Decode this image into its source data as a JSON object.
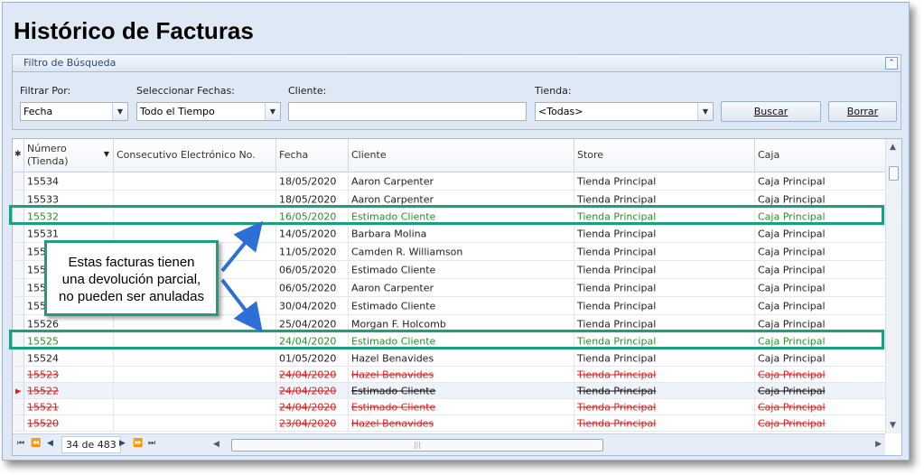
{
  "page": {
    "title": "Histórico de Facturas"
  },
  "filter": {
    "header": "Filtro de Búsqueda",
    "filter_by_label": "Filtrar Por:",
    "filter_by_value": "Fecha",
    "dates_label": "Seleccionar Fechas:",
    "dates_value": "Todo el Tiempo",
    "client_label": "Cliente:",
    "client_value": "",
    "store_label": "Tienda:",
    "store_value": "<Todas>",
    "search_button": "Buscar",
    "clear_button": "Borrar"
  },
  "grid": {
    "headers": {
      "numero_line1": "Número",
      "numero_line2": "(Tienda)",
      "consecutivo": "Consecutivo Electrónico No.",
      "fecha": "Fecha",
      "cliente": "Cliente",
      "store": "Store",
      "caja": "Caja"
    },
    "rows": [
      {
        "numero": "15534",
        "fecha": "18/05/2020",
        "cliente": "Aaron Carpenter",
        "store": "Tienda Principal",
        "caja": "Caja Principal",
        "status": "normal"
      },
      {
        "numero": "15533",
        "fecha": "18/05/2020",
        "cliente": "Aaron Carpenter",
        "store": "Tienda Principal",
        "caja": "Caja Principal",
        "status": "normal"
      },
      {
        "numero": "15532",
        "fecha": "16/05/2020",
        "cliente": "Estimado Cliente",
        "store": "Tienda Principal",
        "caja": "Caja Principal",
        "status": "partial"
      },
      {
        "numero": "15531",
        "fecha": "14/05/2020",
        "cliente": "Barbara Molina",
        "store": "Tienda Principal",
        "caja": "Caja Principal",
        "status": "normal"
      },
      {
        "numero": "15530",
        "fecha": "11/05/2020",
        "cliente": "Camden R. Williamson",
        "store": "Tienda Principal",
        "caja": "Caja Principal",
        "status": "normal"
      },
      {
        "numero": "15529",
        "fecha": "06/05/2020",
        "cliente": "Estimado Cliente",
        "store": "Tienda Principal",
        "caja": "Caja Principal",
        "status": "normal"
      },
      {
        "numero": "15528",
        "fecha": "06/05/2020",
        "cliente": "Aaron Carpenter",
        "store": "Tienda Principal",
        "caja": "Caja Principal",
        "status": "normal"
      },
      {
        "numero": "15527",
        "fecha": "30/04/2020",
        "cliente": "Estimado Cliente",
        "store": "Tienda Principal",
        "caja": "Caja Principal",
        "status": "normal"
      },
      {
        "numero": "15526",
        "fecha": "25/04/2020",
        "cliente": "Morgan F. Holcomb",
        "store": "Tienda Principal",
        "caja": "Caja Principal",
        "status": "normal"
      },
      {
        "numero": "15525",
        "fecha": "24/04/2020",
        "cliente": "Estimado Cliente",
        "store": "Tienda Principal",
        "caja": "Caja Principal",
        "status": "partial"
      },
      {
        "numero": "15524",
        "fecha": "01/05/2020",
        "cliente": "Hazel Benavides",
        "store": "Tienda Principal",
        "caja": "Caja Principal",
        "status": "normal"
      },
      {
        "numero": "15523",
        "fecha": "24/04/2020",
        "cliente": "Hazel Benavides",
        "store": "Tienda Principal",
        "caja": "Caja Principal",
        "status": "voided"
      },
      {
        "numero": "15522",
        "fecha": "24/04/2020",
        "cliente": "Estimado Cliente",
        "store": "Tienda Principal",
        "caja": "Caja Principal",
        "status": "voided-current"
      },
      {
        "numero": "15521",
        "fecha": "24/04/2020",
        "cliente": "Estimado Cliente",
        "store": "Tienda Principal",
        "caja": "Caja Principal",
        "status": "voided"
      },
      {
        "numero": "15520",
        "fecha": "23/04/2020",
        "cliente": "Hazel Benavides",
        "store": "Tienda Principal",
        "caja": "Caja Principal",
        "status": "voided"
      }
    ]
  },
  "navigator": {
    "position": "34 de 483"
  },
  "callout": {
    "line1": "Estas facturas tienen",
    "line2": "una devolución parcial,",
    "line3": "no pueden ser anuladas"
  },
  "colors": {
    "highlight": "#1e9d7f",
    "partial_text": "#2e8a2e",
    "voided_text": "#d21f1f",
    "arrow": "#2c6fd6"
  }
}
